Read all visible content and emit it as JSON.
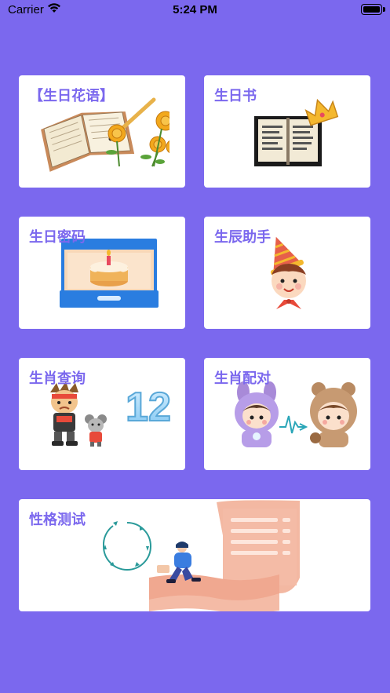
{
  "status_bar": {
    "carrier": "Carrier",
    "time": "5:24 PM"
  },
  "cards": [
    {
      "label": "【生日花语】",
      "icon": "book-with-roses-icon"
    },
    {
      "label": "生日书",
      "icon": "pixel-book-with-crown-icon"
    },
    {
      "label": "生日密码",
      "icon": "cake-in-box-icon"
    },
    {
      "label": "生辰助手",
      "icon": "party-hat-child-icon"
    },
    {
      "label": "生肖查询",
      "icon": "zodiac-characters-icon",
      "badge": "12"
    },
    {
      "label": "生肖配对",
      "icon": "costume-kids-pair-icon"
    },
    {
      "label": "性格测试",
      "icon": "scroll-with-person-icon"
    }
  ],
  "colors": {
    "background": "#7B68EE",
    "label": "#7B68EE",
    "card": "#FFFFFF"
  }
}
